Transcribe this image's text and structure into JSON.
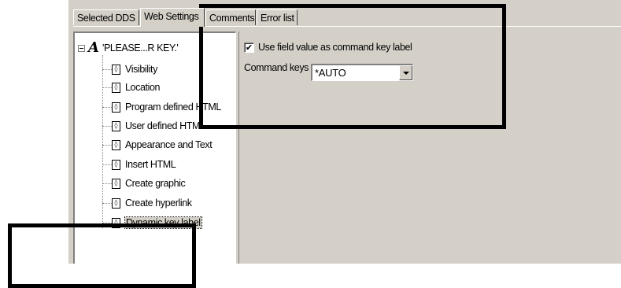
{
  "tabs": [
    {
      "label": "Selected DDS",
      "active": false
    },
    {
      "label": "Web Settings",
      "active": true
    },
    {
      "label": "Comments",
      "active": false
    },
    {
      "label": "Error list",
      "active": false
    }
  ],
  "tree": {
    "root_label": "'PLEASE...R KEY.'",
    "root_icon": "A",
    "node_icon_glyph": "◊",
    "items": [
      {
        "label": "Visibility"
      },
      {
        "label": "Location"
      },
      {
        "label": "Program defined HTML"
      },
      {
        "label": "User defined HTML"
      },
      {
        "label": "Appearance and Text"
      },
      {
        "label": "Insert HTML"
      },
      {
        "label": "Create graphic"
      },
      {
        "label": "Create hyperlink"
      },
      {
        "label": "Dynamic key label",
        "selected": true
      }
    ]
  },
  "settings": {
    "use_field_value_label": "Use field value as command key label",
    "use_field_value_checked": true,
    "check_glyph": "✔",
    "command_keys_label": "Command keys",
    "command_keys_value": "*AUTO"
  },
  "colors": {
    "window_background": "#d4d0c8",
    "annotation_border": "#000000"
  }
}
